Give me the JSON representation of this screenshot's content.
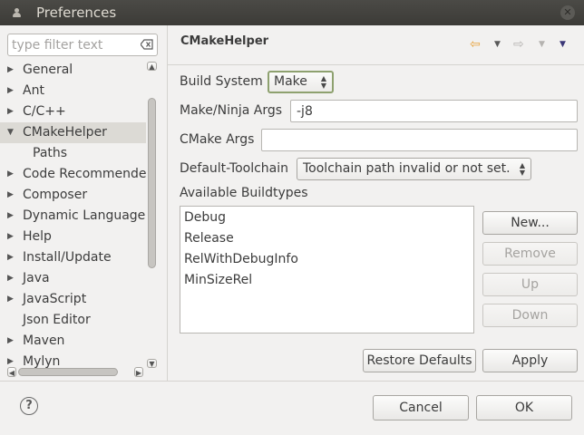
{
  "window": {
    "title": "Preferences",
    "close_symbol": "✕"
  },
  "sidebar": {
    "filter_placeholder": "type filter text",
    "tree": [
      {
        "label": "General",
        "arrow": "▶"
      },
      {
        "label": "Ant",
        "arrow": "▶"
      },
      {
        "label": "C/C++",
        "arrow": "▶"
      },
      {
        "label": "CMakeHelper",
        "arrow": "▼",
        "selected": true
      },
      {
        "label": "Paths",
        "child": true
      },
      {
        "label": "Code Recommenders",
        "arrow": "▶"
      },
      {
        "label": "Composer",
        "arrow": "▶"
      },
      {
        "label": "Dynamic Languages",
        "arrow": "▶"
      },
      {
        "label": "Help",
        "arrow": "▶"
      },
      {
        "label": "Install/Update",
        "arrow": "▶"
      },
      {
        "label": "Java",
        "arrow": "▶"
      },
      {
        "label": "JavaScript",
        "arrow": "▶"
      },
      {
        "label": "Json Editor"
      },
      {
        "label": "Maven",
        "arrow": "▶"
      },
      {
        "label": "Mylyn",
        "arrow": "▶"
      }
    ]
  },
  "page": {
    "title": "CMakeHelper",
    "nav": {
      "back": "⇦",
      "forward": "⇨",
      "dropdown": "▼",
      "menu": "▼"
    },
    "build_system": {
      "label": "Build System",
      "value": "Make"
    },
    "make_args": {
      "label": "Make/Ninja Args",
      "value": "-j8"
    },
    "cmake_args": {
      "label": "CMake Args",
      "value": ""
    },
    "toolchain": {
      "label": "Default-Toolchain",
      "value": "Toolchain path invalid or not set."
    },
    "buildtypes": {
      "label": "Available Buildtypes",
      "items": [
        "Debug",
        "Release",
        "RelWithDebugInfo",
        "MinSizeRel"
      ]
    },
    "buttons": {
      "new": "New...",
      "remove": "Remove",
      "up": "Up",
      "down": "Down",
      "restore_defaults": "Restore Defaults",
      "apply": "Apply"
    }
  },
  "footer": {
    "help": "?",
    "cancel": "Cancel",
    "ok": "OK"
  },
  "colors": {
    "nav_active": "#e8a33d",
    "nav_inactive": "#b5b3b0",
    "nav_menu": "#3b3777"
  }
}
